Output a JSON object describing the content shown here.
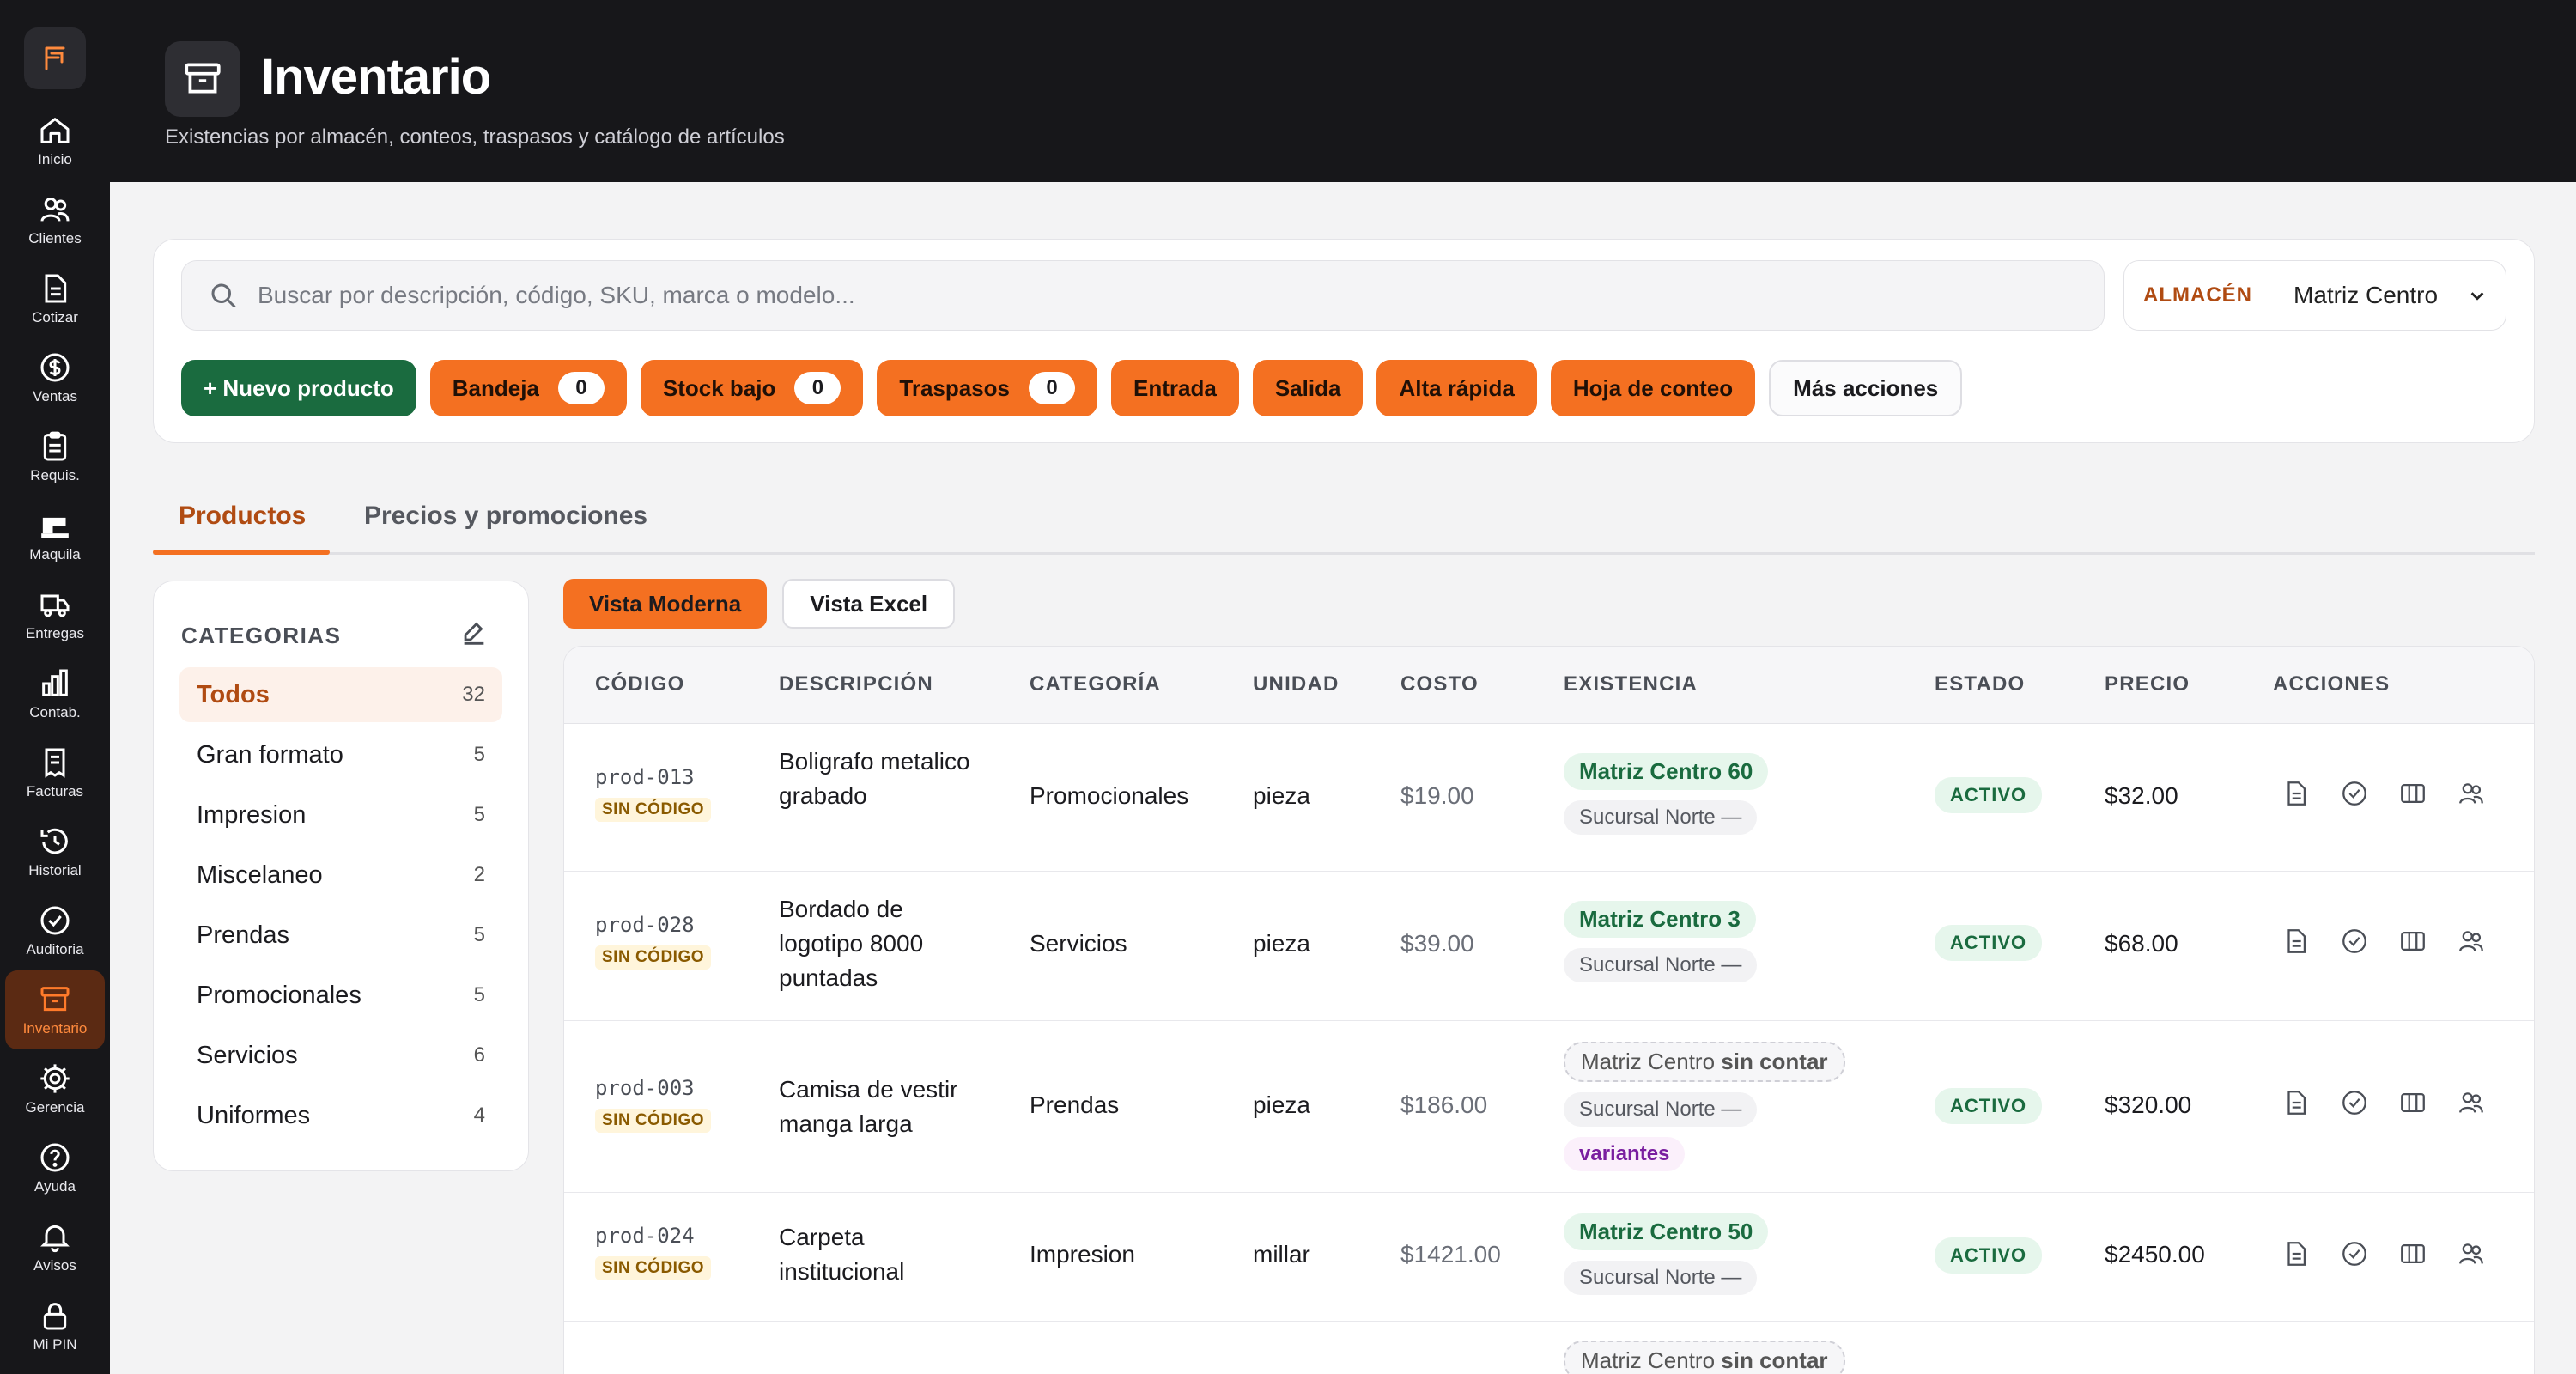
{
  "sidebar": {
    "items": [
      {
        "label": "Inicio",
        "icon": "home-icon"
      },
      {
        "label": "Clientes",
        "icon": "users-icon"
      },
      {
        "label": "Cotizar",
        "icon": "document-icon"
      },
      {
        "label": "Ventas",
        "icon": "dollar-icon"
      },
      {
        "label": "Requis.",
        "icon": "clipboard-icon"
      },
      {
        "label": "Maquila",
        "icon": "sewing-machine-icon"
      },
      {
        "label": "Entregas",
        "icon": "truck-icon"
      },
      {
        "label": "Contab.",
        "icon": "bar-chart-icon"
      },
      {
        "label": "Facturas",
        "icon": "receipt-icon"
      },
      {
        "label": "Historial",
        "icon": "history-icon"
      },
      {
        "label": "Auditoria",
        "icon": "check-circle-icon"
      },
      {
        "label": "Inventario",
        "icon": "archive-icon"
      },
      {
        "label": "Gerencia",
        "icon": "gear-icon"
      },
      {
        "label": "Ayuda",
        "icon": "help-icon"
      },
      {
        "label": "Avisos",
        "icon": "bell-icon"
      },
      {
        "label": "Mi PIN",
        "icon": "lock-icon"
      }
    ],
    "active": "Inventario"
  },
  "header": {
    "title": "Inventario",
    "subtitle": "Existencias por almacén, conteos, traspasos y catálogo de artículos"
  },
  "toolbar": {
    "search_placeholder": "Buscar por descripción, código, SKU, marca o modelo...",
    "warehouse_label": "ALMACÉN",
    "warehouse_value": "Matriz Centro",
    "new_product": "+ Nuevo producto",
    "bandeja": "Bandeja",
    "bandeja_count": "0",
    "stock_bajo": "Stock bajo",
    "stock_bajo_count": "0",
    "traspasos": "Traspasos",
    "traspasos_count": "0",
    "entrada": "Entrada",
    "salida": "Salida",
    "alta_rapida": "Alta rápida",
    "hoja_conteo": "Hoja de conteo",
    "mas_acciones": "Más acciones"
  },
  "tabs": {
    "productos": "Productos",
    "precios": "Precios y promociones"
  },
  "categories": {
    "title": "CATEGORIAS",
    "items": [
      {
        "name": "Todos",
        "count": "32"
      },
      {
        "name": "Gran formato",
        "count": "5"
      },
      {
        "name": "Impresion",
        "count": "5"
      },
      {
        "name": "Miscelaneo",
        "count": "2"
      },
      {
        "name": "Prendas",
        "count": "5"
      },
      {
        "name": "Promocionales",
        "count": "5"
      },
      {
        "name": "Servicios",
        "count": "6"
      },
      {
        "name": "Uniformes",
        "count": "4"
      }
    ]
  },
  "view": {
    "moderna": "Vista Moderna",
    "excel": "Vista Excel"
  },
  "table": {
    "headers": {
      "codigo": "CÓDIGO",
      "descripcion": "DESCRIPCIÓN",
      "categoria": "CATEGORÍA",
      "unidad": "UNIDAD",
      "costo": "COSTO",
      "existencia": "EXISTENCIA",
      "estado": "ESTADO",
      "precio": "PRECIO",
      "acciones": "ACCIONES"
    },
    "rows": [
      {
        "code": "prod-013",
        "badge": "SIN CÓDIGO",
        "description": "Boligrafo metalico grabado",
        "category": "Promocionales",
        "unit": "pieza",
        "cost": "$19.00",
        "stock_main": "Matriz Centro",
        "stock_main_qty": "60",
        "stock_branch": "Sucursal Norte —",
        "status": "ACTIVO",
        "price": "$32.00"
      },
      {
        "code": "prod-028",
        "badge": "SIN CÓDIGO",
        "description": "Bordado de logotipo 8000 puntadas",
        "category": "Servicios",
        "unit": "pieza",
        "cost": "$39.00",
        "stock_main": "Matriz Centro",
        "stock_main_qty": "3",
        "stock_branch": "Sucursal Norte —",
        "status": "ACTIVO",
        "price": "$68.00"
      },
      {
        "code": "prod-003",
        "badge": "SIN CÓDIGO",
        "description": "Camisa de vestir manga larga",
        "category": "Prendas",
        "unit": "pieza",
        "cost": "$186.00",
        "stock_main": "Matriz Centro",
        "stock_main_qty": "sin contar",
        "stock_branch": "Sucursal Norte —",
        "variants": "variantes",
        "status": "ACTIVO",
        "price": "$320.00"
      },
      {
        "code": "prod-024",
        "badge": "SIN CÓDIGO",
        "description": "Carpeta institucional",
        "category": "Impresion",
        "unit": "millar",
        "cost": "$1421.00",
        "stock_main": "Matriz Centro",
        "stock_main_qty": "50",
        "stock_branch": "Sucursal Norte —",
        "status": "ACTIVO",
        "price": "$2450.00"
      },
      {
        "stock_main": "Matriz Centro",
        "stock_main_qty": "sin contar"
      }
    ]
  },
  "colors": {
    "accent": "#f47021",
    "accent_dark": "#b04b12",
    "green": "#1a6b3f",
    "sidebar_bg": "#17171a"
  }
}
